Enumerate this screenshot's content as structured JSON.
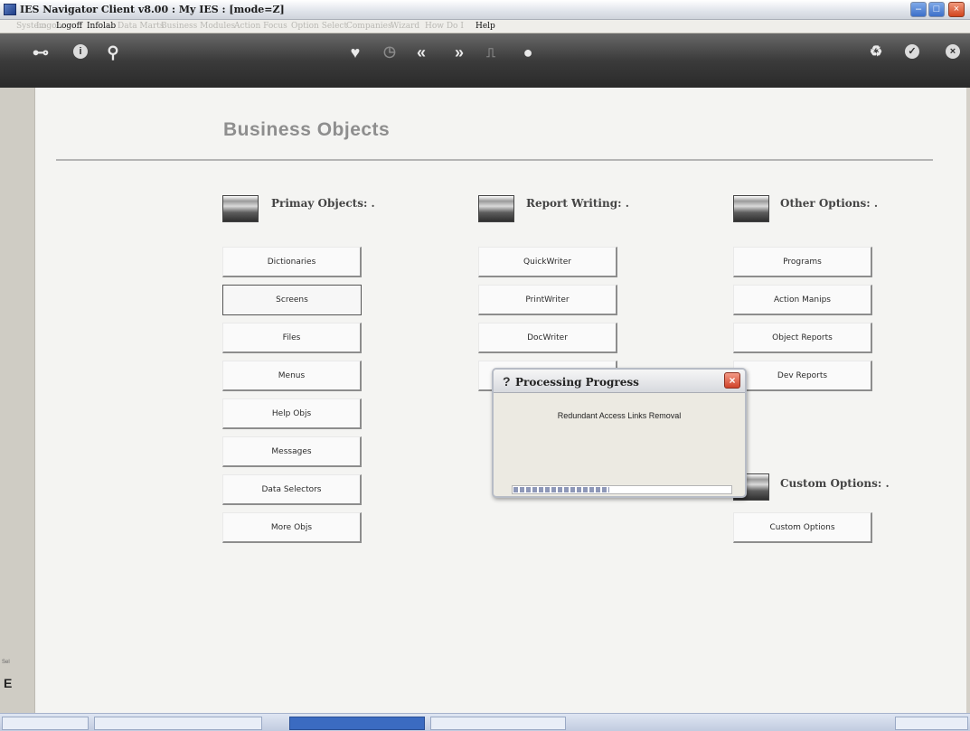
{
  "window": {
    "title": "IES Navigator Client v8.00 : My IES :     [mode=Z]",
    "minimize_icon": "minimize-icon",
    "maximize_icon": "maximize-icon",
    "close_icon": "close-icon"
  },
  "menu": {
    "items": [
      {
        "label": "System",
        "enabled": false
      },
      {
        "label": "Logon",
        "enabled": false
      },
      {
        "label": "Logoff",
        "enabled": true
      },
      {
        "label": "Infolab",
        "enabled": true
      },
      {
        "label": "Data Marts",
        "enabled": false
      },
      {
        "label": "Business Modules",
        "enabled": false
      },
      {
        "label": "Action Focus",
        "enabled": false
      },
      {
        "label": "Option Select",
        "enabled": false
      },
      {
        "label": "Companies",
        "enabled": false
      },
      {
        "label": "Wizard",
        "enabled": false
      },
      {
        "label": "How Do I",
        "enabled": false
      },
      {
        "label": "Help",
        "enabled": true
      }
    ]
  },
  "toolbar": {
    "icons": [
      "key-icon",
      "info-icon",
      "search-icon",
      "heart-icon",
      "clock-icon",
      "back-icon",
      "forward-icon",
      "print-icon",
      "stop-icon",
      "refresh-icon",
      "check-icon",
      "exit-icon"
    ]
  },
  "main": {
    "title": "Business Objects",
    "sections": {
      "primary": {
        "label": "Primay Objects: .",
        "buttons": [
          "Dictionaries",
          "Screens",
          "Files",
          "Menus",
          "Help Objs",
          "Messages",
          "Data Selectors",
          "More Objs"
        ]
      },
      "report": {
        "label": "Report Writing: .",
        "buttons": [
          "QuickWriter",
          "PrintWriter",
          "DocWriter"
        ]
      },
      "other": {
        "label": "Other Options: .",
        "buttons": [
          "Programs",
          "Action Manips",
          "Object Reports",
          "Dev Reports"
        ]
      },
      "custom": {
        "label": "Custom Options: .",
        "buttons": [
          "Custom Options"
        ]
      }
    }
  },
  "dialog": {
    "title": "Processing Progress",
    "message": "Redundant Access Links Removal",
    "progress_fraction": 0.44
  },
  "left_panel": {
    "letter": "E"
  },
  "colors": {
    "toolbar_bg": "#3b3b3b",
    "panel_bg": "#f4f4f2",
    "accent": "#3b6bc1"
  }
}
